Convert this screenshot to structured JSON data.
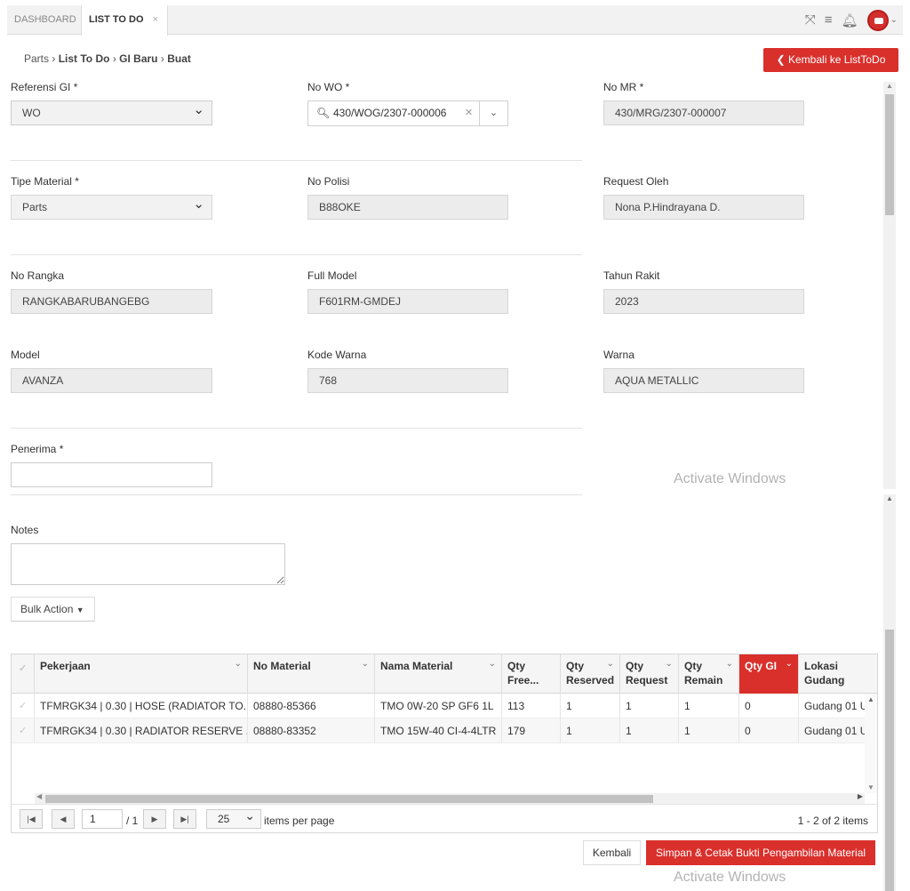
{
  "tabs": [
    {
      "label": "DASHBOARD"
    },
    {
      "label": "LIST TO DO",
      "close": "×"
    }
  ],
  "header_icons": [
    "expand-icon",
    "menu-icon",
    "bell-icon",
    "avatar"
  ],
  "breadcrumb": {
    "root": "Parts",
    "sep": "›",
    "l1": "List To Do",
    "l2": "GI Baru",
    "l3": "Buat"
  },
  "back_button": "Kembali ke ListToDo",
  "form": {
    "referensi_gi": {
      "label": "Referensi GI *",
      "value": "WO"
    },
    "no_wo": {
      "label": "No WO *",
      "value": "430/WOG/2307-000006"
    },
    "no_mr": {
      "label": "No MR *",
      "value": "430/MRG/2307-000007"
    },
    "tipe_material": {
      "label": "Tipe Material *",
      "value": "Parts"
    },
    "no_polisi": {
      "label": "No Polisi",
      "value": "B88OKE"
    },
    "request_oleh": {
      "label": "Request Oleh",
      "value": "Nona P.Hindrayana D."
    },
    "no_rangka": {
      "label": "No Rangka",
      "value": "RANGKABARUBANGEBG"
    },
    "full_model": {
      "label": "Full Model",
      "value": "F601RM-GMDEJ"
    },
    "tahun_rakit": {
      "label": "Tahun Rakit",
      "value": "2023"
    },
    "model": {
      "label": "Model",
      "value": "AVANZA"
    },
    "kode_warna": {
      "label": "Kode Warna",
      "value": "768"
    },
    "warna": {
      "label": "Warna",
      "value": "AQUA METALLIC"
    },
    "penerima": {
      "label": "Penerima *",
      "value": ""
    },
    "notes": {
      "label": "Notes",
      "value": ""
    }
  },
  "watermark": "Activate Windows",
  "bulk_action": "Bulk Action",
  "grid": {
    "columns": [
      "Pekerjaan",
      "No Material",
      "Nama Material",
      "Qty Free...",
      "Qty Reserved",
      "Qty Request",
      "Qty Remain",
      "Qty GI",
      "Lokasi Gudang"
    ],
    "rows": [
      [
        "TFMRGK34 | 0.30 | HOSE (RADIATOR TO...",
        "08880-85366",
        "TMO 0W-20 SP GF6 1L",
        "113",
        "1",
        "1",
        "1",
        "0",
        "Gudang 01 U"
      ],
      [
        "TFMRGK34 | 0.30 | RADIATOR RESERVE ...",
        "08880-83352",
        "TMO 15W-40 CI-4-4LTR",
        "179",
        "1",
        "1",
        "1",
        "0",
        "Gudang 01 U"
      ]
    ]
  },
  "pager": {
    "page": "1",
    "of": "/ 1",
    "size": "25",
    "items_per_page": "items per page",
    "count": "1 - 2 of 2 items"
  },
  "buttons": {
    "kembali": "Kembali",
    "save": "Simpan & Cetak Bukti Pengambilan Material"
  }
}
